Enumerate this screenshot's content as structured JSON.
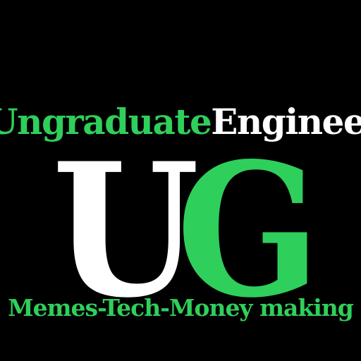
{
  "logo": {
    "wordmark_part1": "Ungraduate",
    "wordmark_part2": "Engineer",
    "monogram_letter1": "U",
    "monogram_letter2": "G",
    "tagline": "Memes-Tech-Money making"
  },
  "colors": {
    "background": "#000000",
    "accent_green": "#2fcf5b",
    "white": "#ffffff"
  }
}
